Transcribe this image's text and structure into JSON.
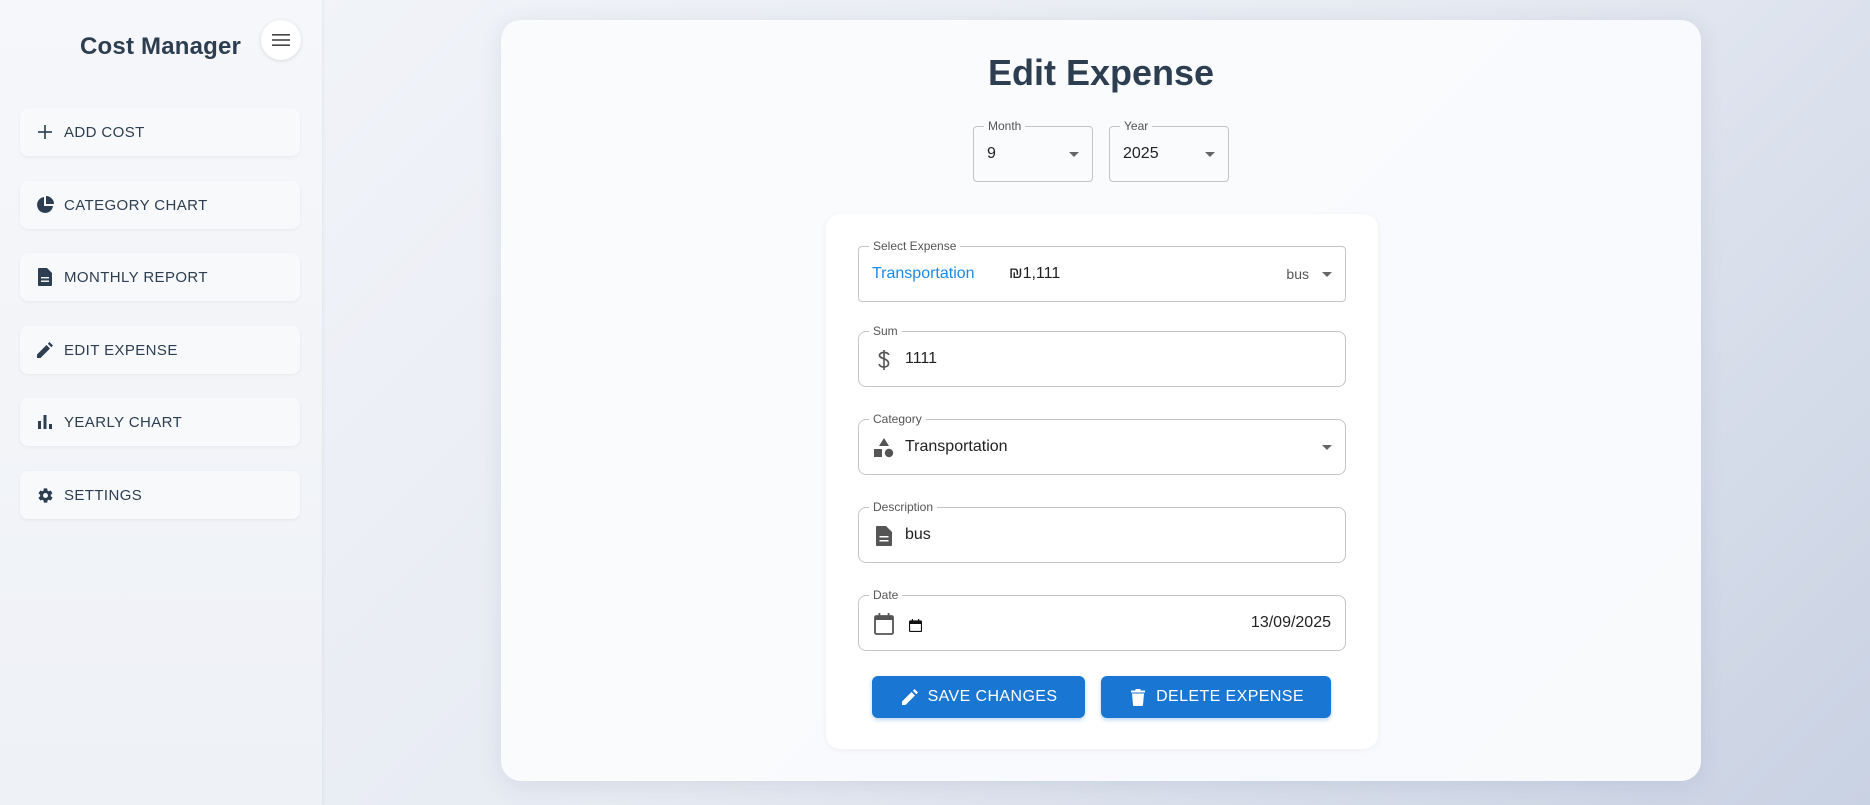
{
  "app": {
    "title": "Cost Manager"
  },
  "sidebar": {
    "items": [
      {
        "label": "ADD COST",
        "icon": "plus-icon"
      },
      {
        "label": "CATEGORY CHART",
        "icon": "pie-chart-icon"
      },
      {
        "label": "MONTHLY REPORT",
        "icon": "document-icon"
      },
      {
        "label": "EDIT EXPENSE",
        "icon": "pencil-icon"
      },
      {
        "label": "YEARLY CHART",
        "icon": "bar-chart-icon"
      },
      {
        "label": "SETTINGS",
        "icon": "gear-icon"
      }
    ]
  },
  "main": {
    "title": "Edit Expense",
    "month": {
      "label": "Month",
      "value": "9"
    },
    "year": {
      "label": "Year",
      "value": "2025"
    },
    "form": {
      "select_expense": {
        "label": "Select Expense",
        "category": "Transportation",
        "amount": "₪1,111",
        "description": "bus"
      },
      "sum": {
        "label": "Sum",
        "value": "1111",
        "icon": "dollar-icon"
      },
      "category": {
        "label": "Category",
        "value": "Transportation",
        "icon": "shapes-icon"
      },
      "description": {
        "label": "Description",
        "value": "bus",
        "icon": "document-icon"
      },
      "date": {
        "label": "Date",
        "value": "13/09/2025",
        "icon": "calendar-icon"
      },
      "save_label": "SAVE CHANGES",
      "delete_label": "DELETE EXPENSE"
    }
  },
  "colors": {
    "accent": "#1976d2",
    "link": "#1e88e5",
    "text": "#2c3e50"
  }
}
